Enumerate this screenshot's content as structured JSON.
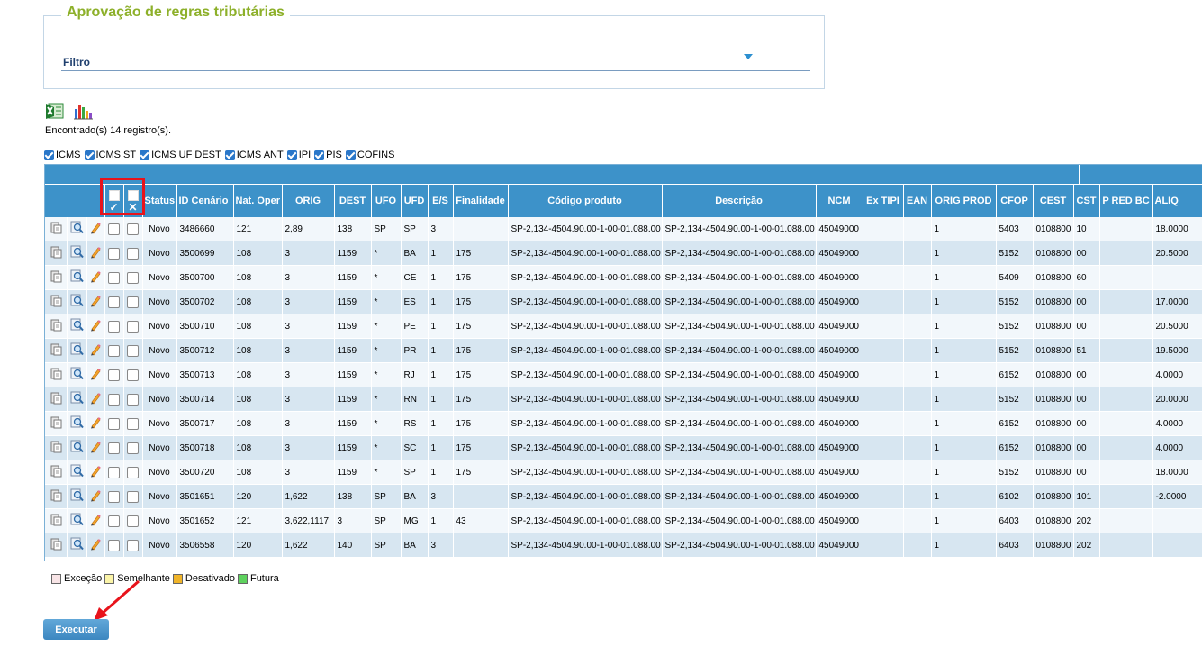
{
  "panel": {
    "title": "Aprovação de regras tributárias",
    "filter_label": "Filtro"
  },
  "toolbar": {
    "excel_icon": "excel-export-icon",
    "chart_icon": "bar-chart-icon"
  },
  "found_text": "Encontrado(s) 14 registro(s).",
  "tax_filters": [
    {
      "label": "ICMS",
      "checked": true
    },
    {
      "label": "ICMS ST",
      "checked": true
    },
    {
      "label": "ICMS UF DEST",
      "checked": true
    },
    {
      "label": "ICMS ANT",
      "checked": true
    },
    {
      "label": "IPI",
      "checked": true
    },
    {
      "label": "PIS",
      "checked": true
    },
    {
      "label": "COFINS",
      "checked": true
    }
  ],
  "header_marks": {
    "approve": "✓",
    "reject": "✕"
  },
  "columns": [
    "Status",
    "ID Cenário",
    "Nat. Oper",
    "ORIG",
    "DEST",
    "UFO",
    "UFD",
    "E/S",
    "Finalidade",
    "Código produto",
    "Descrição",
    "NCM",
    "Ex TIPI",
    "EAN",
    "ORIG PROD",
    "CFOP",
    "CEST",
    "CST",
    "P RED BC",
    "ALIQ"
  ],
  "rows": [
    [
      "Novo",
      "3486660",
      "121",
      "2,89",
      "138",
      "SP",
      "SP",
      "3",
      "",
      "SP-2,134-4504.90.00-1-00-01.088.00",
      "SP-2,134-4504.90.00-1-00-01.088.00",
      "45049000",
      "",
      "",
      "1",
      "5403",
      "0108800",
      "10",
      "",
      "18.0000"
    ],
    [
      "Novo",
      "3500699",
      "108",
      "3",
      "1159",
      "*",
      "BA",
      "1",
      "175",
      "SP-2,134-4504.90.00-1-00-01.088.00",
      "SP-2,134-4504.90.00-1-00-01.088.00",
      "45049000",
      "",
      "",
      "1",
      "5152",
      "0108800",
      "00",
      "",
      "20.5000"
    ],
    [
      "Novo",
      "3500700",
      "108",
      "3",
      "1159",
      "*",
      "CE",
      "1",
      "175",
      "SP-2,134-4504.90.00-1-00-01.088.00",
      "SP-2,134-4504.90.00-1-00-01.088.00",
      "45049000",
      "",
      "",
      "1",
      "5409",
      "0108800",
      "60",
      "",
      ""
    ],
    [
      "Novo",
      "3500702",
      "108",
      "3",
      "1159",
      "*",
      "ES",
      "1",
      "175",
      "SP-2,134-4504.90.00-1-00-01.088.00",
      "SP-2,134-4504.90.00-1-00-01.088.00",
      "45049000",
      "",
      "",
      "1",
      "5152",
      "0108800",
      "00",
      "",
      "17.0000"
    ],
    [
      "Novo",
      "3500710",
      "108",
      "3",
      "1159",
      "*",
      "PE",
      "1",
      "175",
      "SP-2,134-4504.90.00-1-00-01.088.00",
      "SP-2,134-4504.90.00-1-00-01.088.00",
      "45049000",
      "",
      "",
      "1",
      "5152",
      "0108800",
      "00",
      "",
      "20.5000"
    ],
    [
      "Novo",
      "3500712",
      "108",
      "3",
      "1159",
      "*",
      "PR",
      "1",
      "175",
      "SP-2,134-4504.90.00-1-00-01.088.00",
      "SP-2,134-4504.90.00-1-00-01.088.00",
      "45049000",
      "",
      "",
      "1",
      "5152",
      "0108800",
      "51",
      "",
      "19.5000"
    ],
    [
      "Novo",
      "3500713",
      "108",
      "3",
      "1159",
      "*",
      "RJ",
      "1",
      "175",
      "SP-2,134-4504.90.00-1-00-01.088.00",
      "SP-2,134-4504.90.00-1-00-01.088.00",
      "45049000",
      "",
      "",
      "1",
      "6152",
      "0108800",
      "00",
      "",
      "4.0000"
    ],
    [
      "Novo",
      "3500714",
      "108",
      "3",
      "1159",
      "*",
      "RN",
      "1",
      "175",
      "SP-2,134-4504.90.00-1-00-01.088.00",
      "SP-2,134-4504.90.00-1-00-01.088.00",
      "45049000",
      "",
      "",
      "1",
      "5152",
      "0108800",
      "00",
      "",
      "20.0000"
    ],
    [
      "Novo",
      "3500717",
      "108",
      "3",
      "1159",
      "*",
      "RS",
      "1",
      "175",
      "SP-2,134-4504.90.00-1-00-01.088.00",
      "SP-2,134-4504.90.00-1-00-01.088.00",
      "45049000",
      "",
      "",
      "1",
      "6152",
      "0108800",
      "00",
      "",
      "4.0000"
    ],
    [
      "Novo",
      "3500718",
      "108",
      "3",
      "1159",
      "*",
      "SC",
      "1",
      "175",
      "SP-2,134-4504.90.00-1-00-01.088.00",
      "SP-2,134-4504.90.00-1-00-01.088.00",
      "45049000",
      "",
      "",
      "1",
      "6152",
      "0108800",
      "00",
      "",
      "4.0000"
    ],
    [
      "Novo",
      "3500720",
      "108",
      "3",
      "1159",
      "*",
      "SP",
      "1",
      "175",
      "SP-2,134-4504.90.00-1-00-01.088.00",
      "SP-2,134-4504.90.00-1-00-01.088.00",
      "45049000",
      "",
      "",
      "1",
      "5152",
      "0108800",
      "00",
      "",
      "18.0000"
    ],
    [
      "Novo",
      "3501651",
      "120",
      "1,622",
      "138",
      "SP",
      "BA",
      "3",
      "",
      "SP-2,134-4504.90.00-1-00-01.088.00",
      "SP-2,134-4504.90.00-1-00-01.088.00",
      "45049000",
      "",
      "",
      "1",
      "6102",
      "0108800",
      "101",
      "",
      "-2.0000"
    ],
    [
      "Novo",
      "3501652",
      "121",
      "3,622,1117",
      "3",
      "SP",
      "MG",
      "1",
      "43",
      "SP-2,134-4504.90.00-1-00-01.088.00",
      "SP-2,134-4504.90.00-1-00-01.088.00",
      "45049000",
      "",
      "",
      "1",
      "6403",
      "0108800",
      "202",
      "",
      ""
    ],
    [
      "Novo",
      "3506558",
      "120",
      "1,622",
      "140",
      "SP",
      "BA",
      "3",
      "",
      "SP-2,134-4504.90.00-1-00-01.088.00",
      "SP-2,134-4504.90.00-1-00-01.088.00",
      "45049000",
      "",
      "",
      "1",
      "6403",
      "0108800",
      "202",
      "",
      ""
    ]
  ],
  "row_icons": [
    "document-icon",
    "search-magnifier-icon",
    "pencil-edit-icon"
  ],
  "legend": [
    {
      "label": "Exceção",
      "color": "#f8e4e6"
    },
    {
      "label": "Semelhante",
      "color": "#fbf4a8"
    },
    {
      "label": "Desativado",
      "color": "#f0b429"
    },
    {
      "label": "Futura",
      "color": "#5ed25e"
    }
  ],
  "execute_label": "Executar",
  "colors": {
    "accent": "#3d92c9",
    "title": "#8db02a",
    "highlight": "#e8131b"
  }
}
